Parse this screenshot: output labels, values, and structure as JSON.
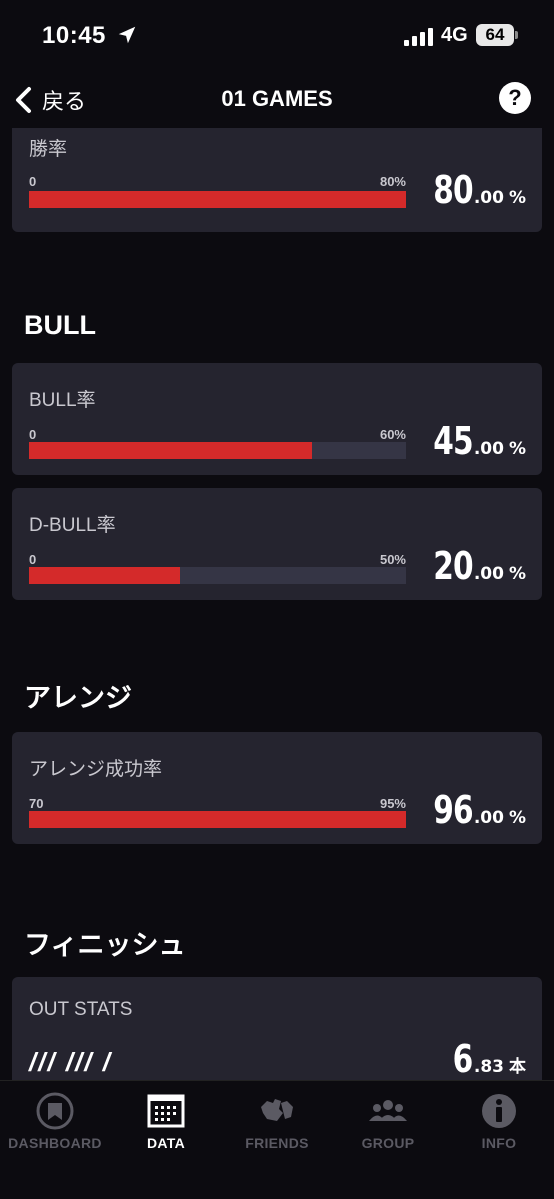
{
  "status_bar": {
    "time": "10:45",
    "network": "4G",
    "battery": "64"
  },
  "nav": {
    "back_label": "戻る",
    "title": "01 GAMES",
    "help_label": "?"
  },
  "cards": [
    {
      "label": "勝率",
      "range_min": "0",
      "range_max": "80%",
      "fill_fraction": 1.0,
      "value_int": "80",
      "value_dec": ".00",
      "unit": "%"
    },
    {
      "label": "BULL率",
      "range_min": "0",
      "range_max": "60%",
      "fill_fraction": 0.75,
      "value_int": "45",
      "value_dec": ".00",
      "unit": "%"
    },
    {
      "label": "D-BULL率",
      "range_min": "0",
      "range_max": "50%",
      "fill_fraction": 0.4,
      "value_int": "20",
      "value_dec": ".00",
      "unit": "%"
    },
    {
      "label": "アレンジ成功率",
      "range_min": "70",
      "range_max": "95%",
      "fill_fraction": 1.0,
      "value_int": "96",
      "value_dec": ".00",
      "unit": "%"
    },
    {
      "label": "OUT STATS",
      "slashes": "/// /// /",
      "value_int": "6",
      "value_dec": ".83",
      "unit": "本"
    }
  ],
  "sections": {
    "bull": "BULL",
    "arrange": "アレンジ",
    "finish": "フィニッシュ"
  },
  "tabs": [
    {
      "label": "DASHBOARD",
      "icon": "dashboard-icon",
      "active": false
    },
    {
      "label": "DATA",
      "icon": "calendar-icon",
      "active": true
    },
    {
      "label": "FRIENDS",
      "icon": "friends-icon",
      "active": false
    },
    {
      "label": "GROUP",
      "icon": "group-icon",
      "active": false
    },
    {
      "label": "INFO",
      "icon": "info-icon",
      "active": false
    }
  ],
  "colors": {
    "accent": "#d42a2a",
    "card": "#25242f",
    "background": "#0c0b10"
  }
}
